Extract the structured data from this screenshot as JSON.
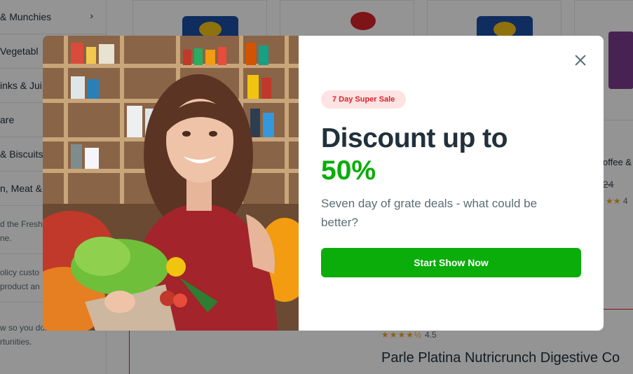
{
  "sidebar": {
    "items": [
      {
        "label": "& Munchies",
        "chevron": "›"
      },
      {
        "label": "Vegetabl"
      },
      {
        "label": "inks & Jui"
      },
      {
        "label": "are"
      },
      {
        "label": "& Biscuits"
      },
      {
        "label": "n, Meat &"
      }
    ],
    "text_blocks": [
      [
        "d the Fresh",
        "ne."
      ],
      [
        "olicy custo",
        "product an"
      ],
      [
        "w so you don t miss",
        "rtunities."
      ]
    ]
  },
  "background": {
    "right_card": {
      "name_fragment": "offee &",
      "price_fragment": "24",
      "stars": "★★",
      "rating_fragment": "4"
    },
    "bottom_product": {
      "stars": "★★★★½",
      "rating": "4.5",
      "title": "Parle Platina Nutricrunch Digestive Co"
    }
  },
  "modal": {
    "badge": "7 Day Super Sale",
    "heading": "Discount up to",
    "heading_highlight": "50%",
    "subtext": "Seven day of grate deals - what could be better?",
    "cta_label": "Start Show Now",
    "close_icon": "close-icon",
    "colors": {
      "accent_green": "#0aad0a",
      "badge_bg": "#fde3e3",
      "badge_text": "#d8232a",
      "heading": "#21313c"
    }
  }
}
